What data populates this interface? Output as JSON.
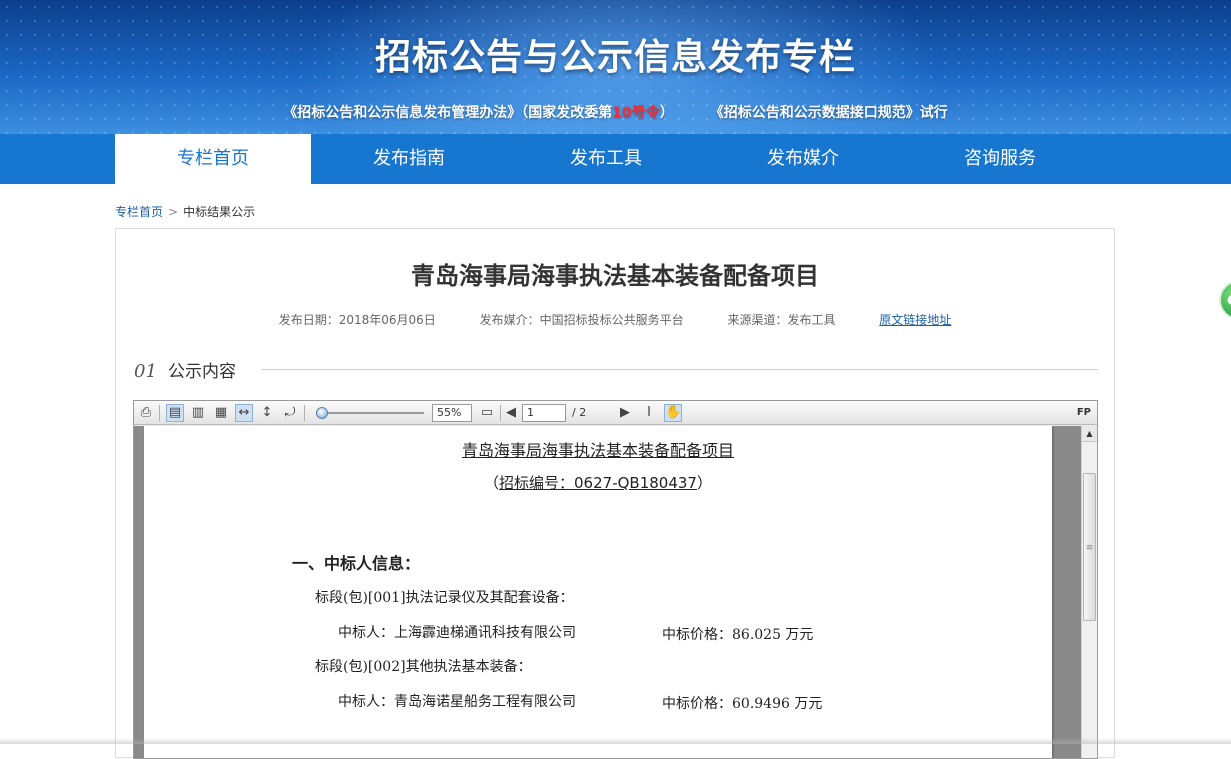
{
  "banner": {
    "title": "招标公告与公示信息发布专栏",
    "sub_part1": "《招标公告和公示信息发布管理办法》（国家发改委第",
    "sub_num": "10号令",
    "sub_part2": "）",
    "sub_part3": "《招标公告和公示数据接口规范》试行"
  },
  "nav": {
    "items": [
      {
        "label": "专栏首页"
      },
      {
        "label": "发布指南"
      },
      {
        "label": "发布工具"
      },
      {
        "label": "发布媒介"
      },
      {
        "label": "咨询服务"
      }
    ]
  },
  "breadcrumb": {
    "home": "专栏首页",
    "separator": ">",
    "current": "中标结果公示"
  },
  "article": {
    "title": "青岛海事局海事执法基本装备配备项目",
    "date": "发布日期：2018年06月06日",
    "media": "发布媒介：中国招标投标公共服务平台",
    "source": "来源渠道：发布工具",
    "original_link": "原文链接地址"
  },
  "section": {
    "number": "01",
    "label": "公示内容"
  },
  "viewer": {
    "zoom": "55%",
    "page_current": "1",
    "page_total": "/ 2",
    "fp_label": "FP",
    "icons": [
      "print-icon",
      "single-page-icon",
      "two-page-icon",
      "thumbnails-icon",
      "fit-width-icon",
      "fit-height-icon",
      "rotate-icon",
      "fullscreen-icon",
      "prev-page-icon",
      "next-page-icon",
      "text-select-icon",
      "hand-tool-icon"
    ]
  },
  "pdf": {
    "title": "青岛海事局海事执法基本装备配备项目",
    "code_open": "（",
    "code": "招标编号：0627-QB180437",
    "code_close": "）",
    "heading": "一、中标人信息：",
    "lot1": "标段(包)[001]执法记录仪及其配套设备：",
    "winner1": "中标人：上海霹迪梯通讯科技有限公司",
    "price1": "中标价格：86.025 万元",
    "lot2": "标段(包)[002]其他执法基本装备：",
    "winner2": "中标人：青岛海诺星船务工程有限公司",
    "price2": "中标价格：60.9496 万元"
  }
}
